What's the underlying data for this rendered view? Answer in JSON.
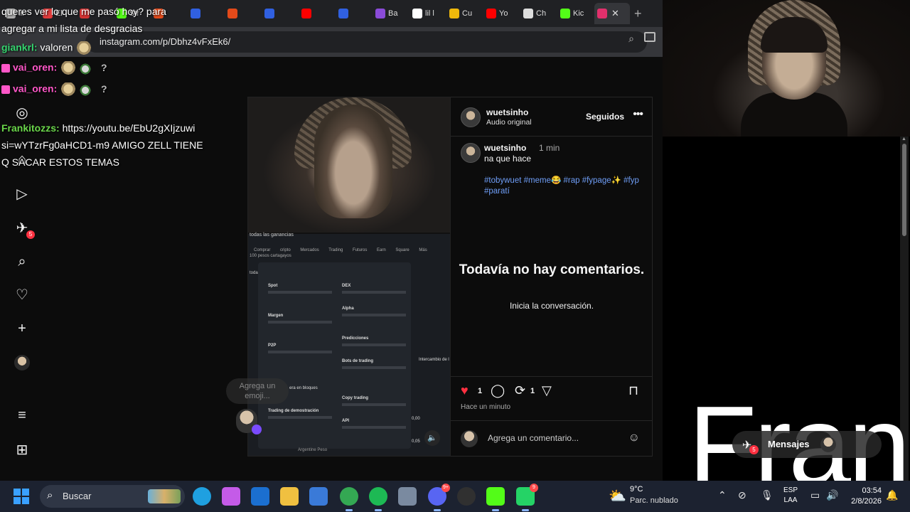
{
  "browser": {
    "tabs": [
      {
        "label": "llı",
        "color": "#aaaaaa"
      },
      {
        "label": "El",
        "color": "#e03c3c"
      },
      {
        "label": "",
        "color": "#d23232"
      },
      {
        "label": "Str",
        "color": "#53fc18"
      },
      {
        "label": "",
        "color": "#e34a1a"
      },
      {
        "label": "",
        "color": "#3060e0"
      },
      {
        "label": "",
        "color": "#e34a1a"
      },
      {
        "label": "",
        "color": "#3060e0"
      },
      {
        "label": "",
        "color": "#ff0000"
      },
      {
        "label": "",
        "color": "#3060e0"
      },
      {
        "label": "Ba",
        "color": "#8a4bd8"
      },
      {
        "label": "lil l",
        "color": "#ffffff"
      },
      {
        "label": "Cu",
        "color": "#f0b90b"
      },
      {
        "label": "Yo",
        "color": "#ff0000"
      },
      {
        "label": "Ch",
        "color": "#dddddd"
      },
      {
        "label": "Kic",
        "color": "#53fc18"
      }
    ],
    "active_tab_color": "#e1306c",
    "close_glyph": "✕",
    "new_tab_glyph": "+",
    "url": "instagram.com/p/Dbhz4vFxEk6/"
  },
  "chat": {
    "lines": [
      {
        "text": "queres ver lo que me pasó hoy? para"
      },
      {
        "text": "agregar a mi lista de desgracias"
      },
      {
        "user": "giankrl",
        "text": "valoren"
      },
      {
        "user": "vai_oren",
        "text": "?"
      },
      {
        "user": "vai_oren",
        "text": "?"
      },
      {
        "user": "Frankitozzs",
        "text": "https://youtu.be/EbU2gXIjzuwi"
      },
      {
        "text": "si=wYTzrFg0aHCD1-m9 AMIGO ZELL TIENE"
      },
      {
        "text": "Q SACAR ESTOS TEMAS"
      }
    ],
    "user_separator": ":"
  },
  "sidenav": {
    "items": [
      {
        "name": "instagram-logo-icon",
        "glyph": "◎"
      },
      {
        "name": "home-icon",
        "glyph": "⌂"
      },
      {
        "name": "reels-icon",
        "glyph": "▷"
      },
      {
        "name": "messages-icon",
        "glyph": "✈",
        "badge": "5"
      },
      {
        "name": "search-icon",
        "glyph": "⌕"
      },
      {
        "name": "notifications-icon",
        "glyph": "♡"
      },
      {
        "name": "create-icon",
        "glyph": "+"
      },
      {
        "name": "profile-avatar",
        "glyph": ""
      },
      {
        "name": "menu-icon",
        "glyph": "≡"
      },
      {
        "name": "more-apps-icon",
        "glyph": "⊞"
      }
    ]
  },
  "media": {
    "screen_title": "todas las ganancias",
    "screen_sub": "100 pesos cartagayos",
    "topnav": "Comprar cripto Mercados Trading Futuros Earn Square Más",
    "menu_left": [
      "Spot",
      "Margen",
      "P2P",
      "Trading de demostración"
    ],
    "menu_right": [
      "DEX",
      "Alpha",
      "Predicciones",
      "Bots de trading",
      "Copy trading",
      "API"
    ],
    "side_label": "Intercambio de l",
    "block_label": "era en bloques",
    "values": [
      "0,00",
      "0,05"
    ],
    "bottom_label": "Argentine Peso",
    "emoji_hint": "Agrega un emoji...",
    "mute_glyph": "🔈"
  },
  "post": {
    "author": "wuetsinho",
    "audio": "Audio original",
    "follow_label": "Seguidos",
    "more_glyph": "•••",
    "caption_user": "wuetsinho",
    "caption_time": "1 min",
    "caption_text": "na que hace",
    "hashtags": "#tobywuet #meme😂 #rap #fypage✨ #fyp #paratí",
    "no_comments": "Todavía no hay comentarios.",
    "start_conversation": "Inicia la conversación.",
    "like_count": "1",
    "repost_count": "1",
    "posted": "Hace un minuto",
    "comment_placeholder": "Agrega un comentario...",
    "icons": {
      "like": "♥",
      "comment": "◯",
      "repost": "⟳",
      "share": "▽",
      "save": "⊓",
      "emoji": "☺"
    }
  },
  "overlay": {
    "big_text": "Fran",
    "messages_label": "Mensajes",
    "messages_badge": "5"
  },
  "taskbar": {
    "search_label": "Buscar",
    "apps": [
      {
        "name": "edge-icon",
        "color": "#1fa0e0"
      },
      {
        "name": "copilot-icon",
        "color": "#c45be8"
      },
      {
        "name": "outlook-icon",
        "color": "#1b6fd0"
      },
      {
        "name": "file-explorer-icon",
        "color": "#f0c040"
      },
      {
        "name": "store-icon",
        "color": "#3a7ad8"
      },
      {
        "name": "chrome-icon",
        "color": "#34a853"
      },
      {
        "name": "spotify-icon",
        "color": "#1db954"
      },
      {
        "name": "settings-icon",
        "color": "#7a8aa0"
      },
      {
        "name": "discord-icon",
        "color": "#5865f2",
        "badge": "9+"
      },
      {
        "name": "obs-icon",
        "color": "#303030"
      },
      {
        "name": "kick-icon",
        "color": "#53fc18"
      },
      {
        "name": "whatsapp-icon",
        "color": "#25d366",
        "badge": "9"
      }
    ],
    "weather_temp": "9°C",
    "weather_desc": "Parc. nublado",
    "lang_1": "ESP",
    "lang_2": "LAA",
    "time": "03:54",
    "date": "2/8/2026"
  }
}
